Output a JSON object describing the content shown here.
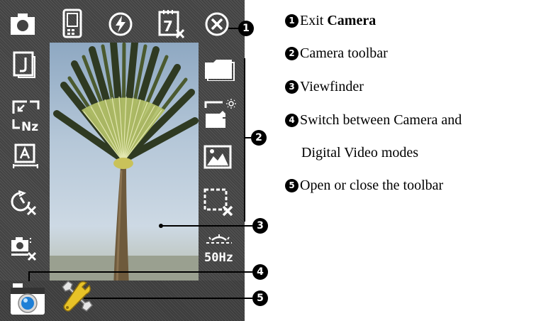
{
  "callouts": {
    "badges": [
      "1",
      "2",
      "3",
      "4",
      "5"
    ]
  },
  "legend": [
    {
      "num": "1",
      "text": "Exit ",
      "bold": "Camera"
    },
    {
      "num": "2",
      "text": "Camera toolbar"
    },
    {
      "num": "3",
      "text": "Viewfinder"
    },
    {
      "num": "4",
      "text": "Switch between Camera and"
    },
    {
      "num": "",
      "text": "Digital Video modes"
    },
    {
      "num": "5",
      "text": "Open or close the toolbar"
    }
  ],
  "toolbar_icons": {
    "top": [
      "camera-mode-icon",
      "device-storage-icon",
      "flash-off-icon",
      "timestamp-off-icon",
      "exit-icon"
    ],
    "left": [
      "jpeg-quality-icon",
      "resolution-icon",
      "auto-focus-icon",
      "self-timer-off-icon",
      "burst-off-icon"
    ],
    "right": [
      "folder-icon",
      "brightness-icon",
      "scene-mode-icon",
      "frame-off-icon",
      "flicker-50hz-icon"
    ]
  },
  "icon_labels": {
    "resolution": "Nz",
    "flicker": "50Hz",
    "timestamp": "7"
  },
  "colors": {
    "screen": "#434343",
    "icon": "#ffffff",
    "lens": "#1e7fd6"
  }
}
